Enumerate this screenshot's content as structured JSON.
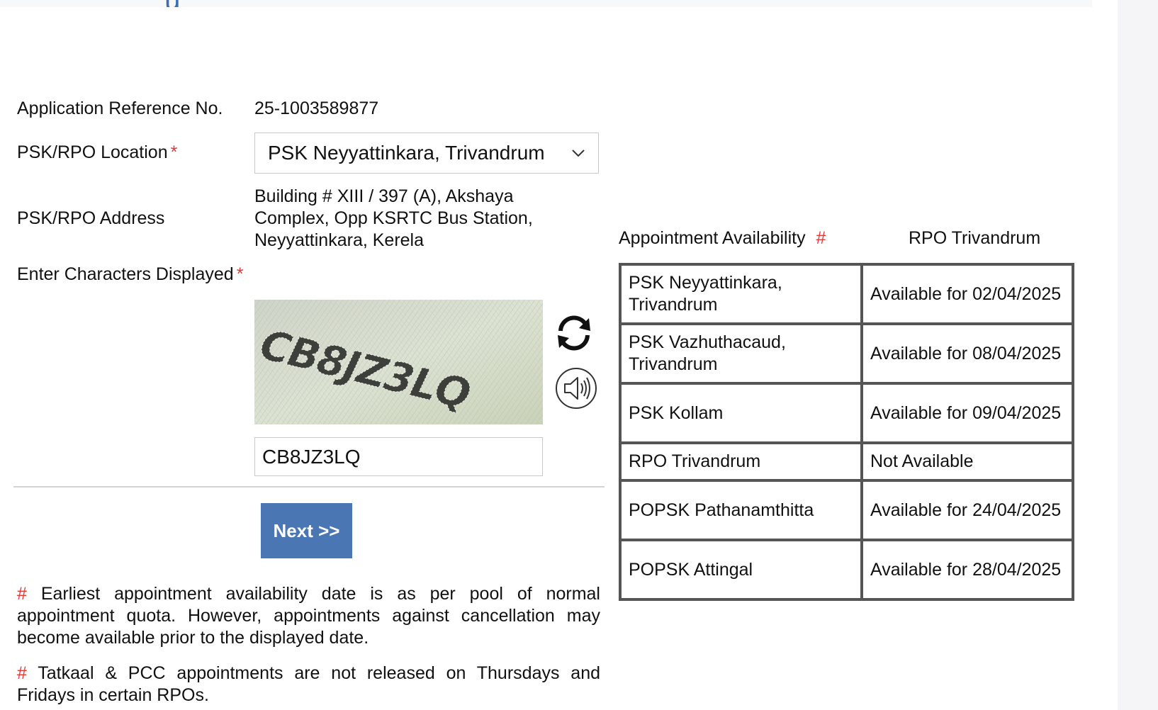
{
  "form": {
    "ref_label": "Application Reference No.",
    "ref_value": "25-1003589877",
    "location_label": "PSK/RPO Location",
    "location_required": "*",
    "location_selected": "PSK Neyyattinkara, Trivandrum",
    "address_label": "PSK/RPO Address",
    "address_value": "Building # XIII / 397 (A), Akshaya Complex, Opp KSRTC Bus Station, Neyyattinkara, Kerela",
    "captcha_label": "Enter Characters Displayed",
    "captcha_required": "*",
    "captcha_image_text": "CB8JZ3LQ",
    "captcha_input_value": "CB8JZ3LQ",
    "next_label": "Next >>"
  },
  "icons": {
    "chevron": "chevron-down-icon",
    "refresh": "refresh-icon",
    "audio": "speaker-icon"
  },
  "availability": {
    "header_label": "Appointment Availability",
    "header_marker": "#",
    "rpo_label": "RPO Trivandrum",
    "rows": [
      {
        "location": "PSK Neyyattinkara, Trivandrum",
        "status": "Available for 02/04/2025"
      },
      {
        "location": "PSK Vazhuthacaud, Trivandrum",
        "status": "Available for 08/04/2025"
      },
      {
        "location": "PSK Kollam",
        "status": "Available for 09/04/2025"
      },
      {
        "location": "RPO Trivandrum",
        "status": "Not Available"
      },
      {
        "location": "POPSK Pathanamthitta",
        "status": "Available for 24/04/2025"
      },
      {
        "location": "POPSK Attingal",
        "status": "Available for 28/04/2025"
      }
    ]
  },
  "notes": {
    "marker": "#",
    "note1": "Earliest appointment availability date is as per pool of normal appointment quota. However, appointments against cancellation may become available prior to the displayed date.",
    "note2": "Tatkaal & PCC appointments are not released on Thursdays and Fridays in certain RPOs."
  },
  "colors": {
    "accent_blue": "#4a77b4",
    "required_red": "#e53935",
    "border_gray": "#555555"
  }
}
